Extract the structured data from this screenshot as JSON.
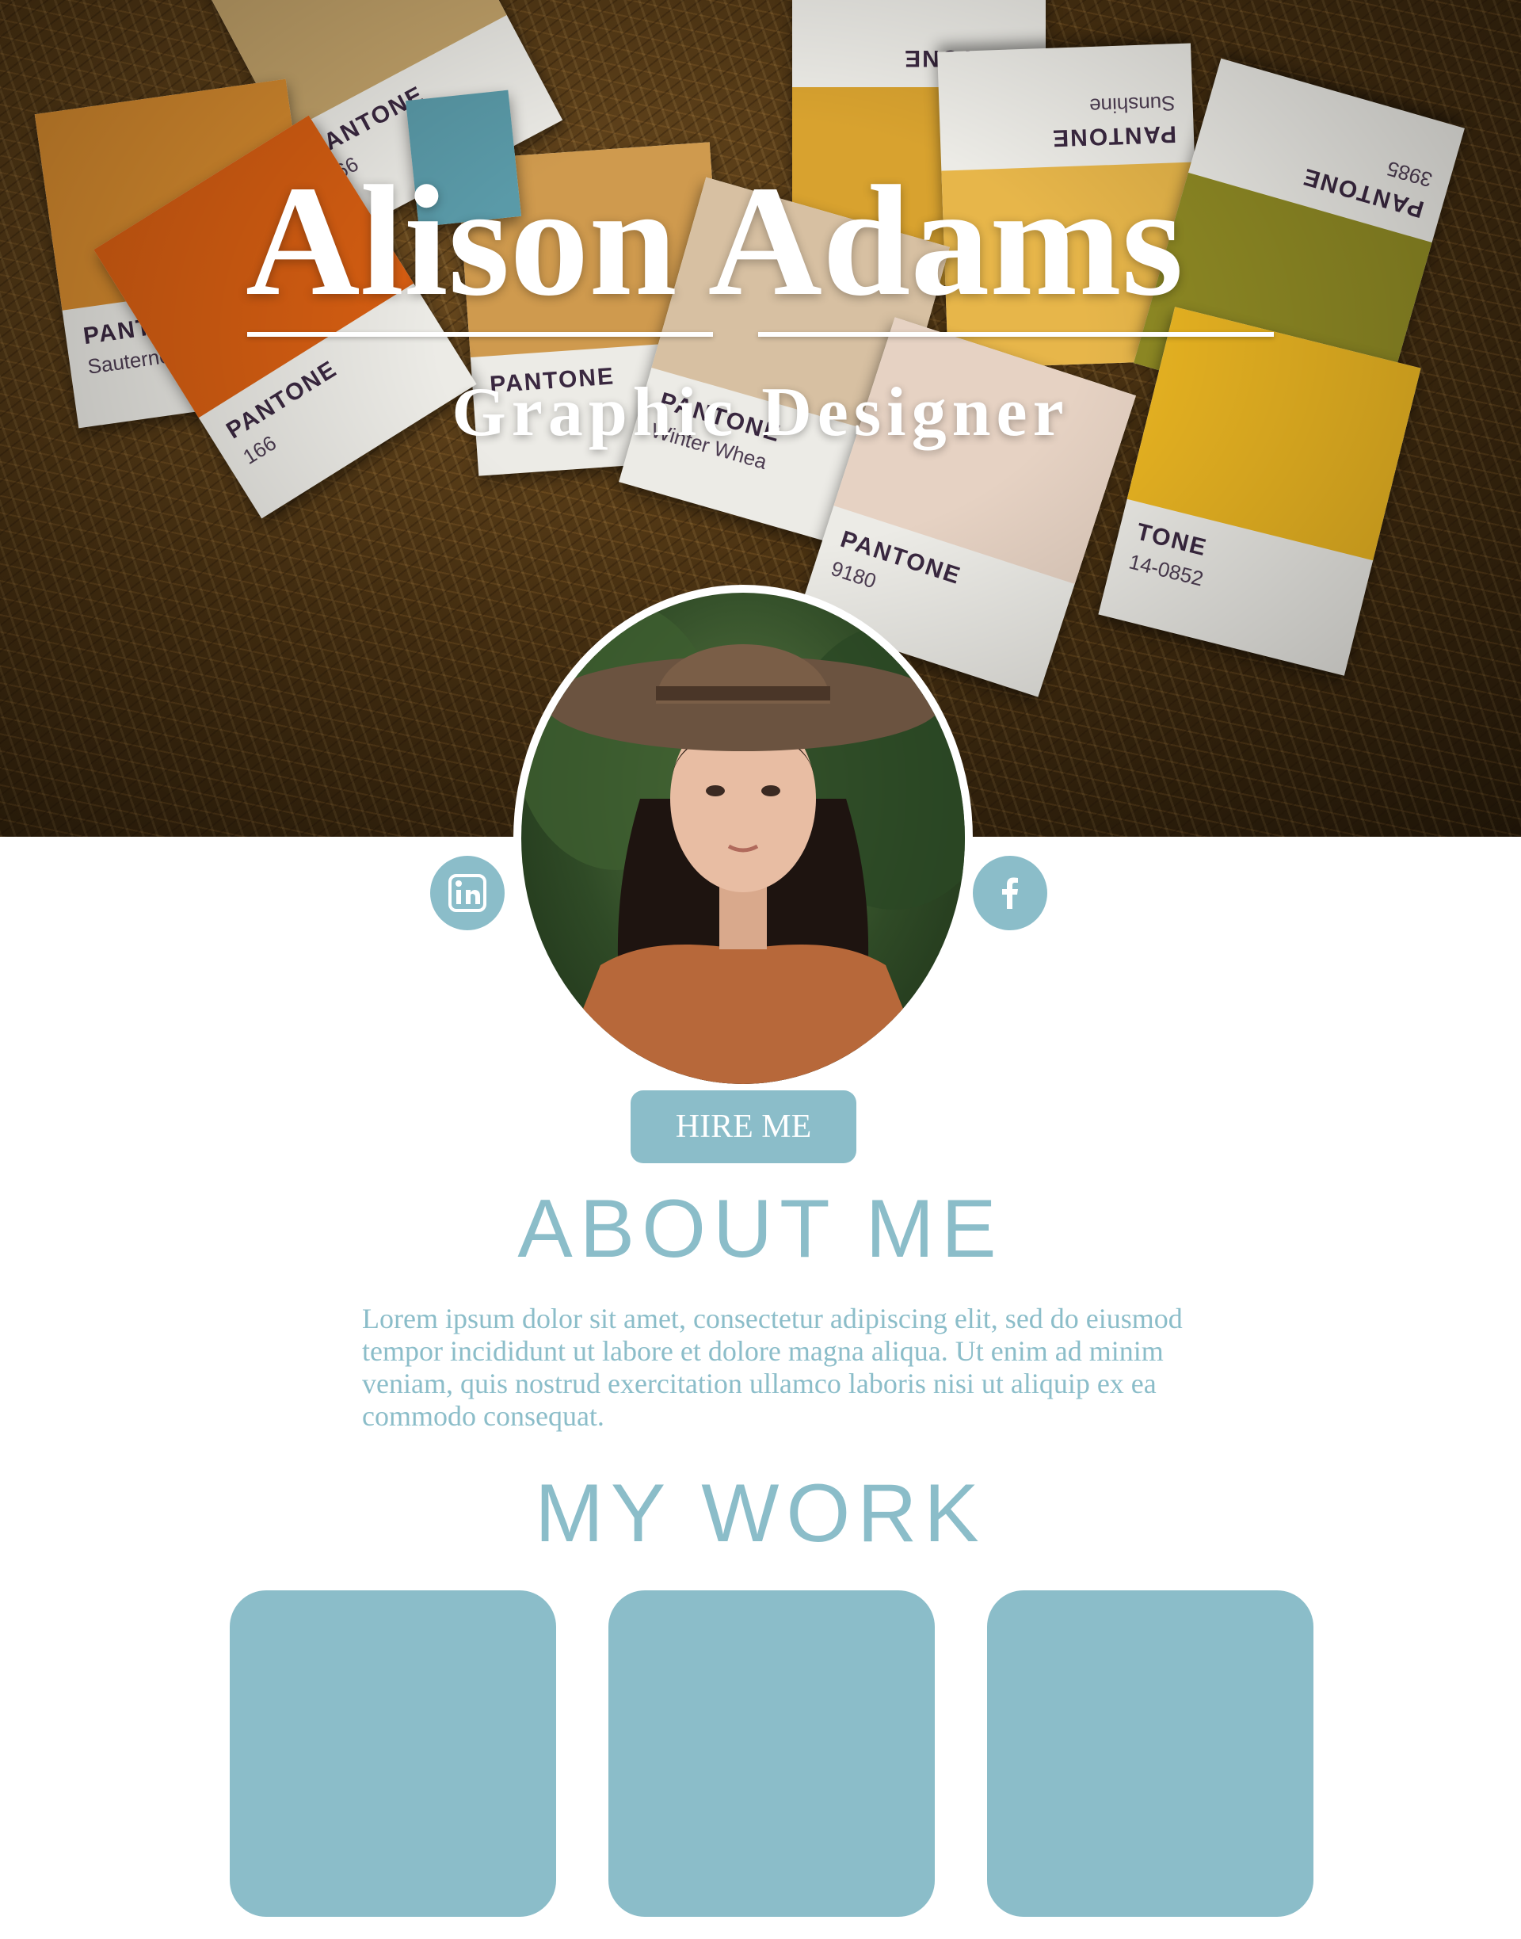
{
  "header": {
    "name": "Alison Adams",
    "title": "Graphic Designer"
  },
  "swatches": [
    {
      "label": "PANTONE",
      "code": "466",
      "color": "#c3a36a"
    },
    {
      "label": "PANTONE",
      "code": "",
      "color": "#d8a22f"
    },
    {
      "label": "PANTONE",
      "code": "",
      "name": "Sunshine",
      "color": "#e7b64a"
    },
    {
      "label": "PANTONE",
      "code": "3985",
      "color": "#8f8a24"
    },
    {
      "label": "PANTONE",
      "code": "",
      "name": "Sauterne",
      "color": "#d58a2e"
    },
    {
      "label": "PANTONE",
      "code": "166",
      "color": "#d65e12"
    },
    {
      "label": "PANTONE",
      "code": "",
      "color": "#cf9a4e"
    },
    {
      "label": "PANTONE",
      "code": "",
      "name": "Winter Whea",
      "color": "#d7c0a2"
    },
    {
      "label": "PANTONE",
      "code": "9180",
      "color": "#e6d2c3"
    },
    {
      "label": "TONE",
      "code": "14-0852",
      "color": "#eab522"
    },
    {
      "label": "PANTONE",
      "code": "",
      "color": "#5a9aa8"
    }
  ],
  "social": {
    "linkedin_icon": "linkedin-icon",
    "facebook_icon": "facebook-icon"
  },
  "cta": {
    "hire_label": "HIRE ME"
  },
  "about": {
    "heading": "ABOUT ME",
    "body": "Lorem ipsum dolor sit amet, consectetur adipiscing elit, sed do eiusmod tempor incididunt ut labore et dolore magna aliqua. Ut enim ad minim veniam, quis nostrud exercitation ullamco laboris nisi ut aliquip ex ea commodo consequat."
  },
  "work": {
    "heading": "MY WORK",
    "tile_count": 3
  },
  "colors": {
    "accent": "#8bbdc9",
    "white": "#ffffff"
  }
}
